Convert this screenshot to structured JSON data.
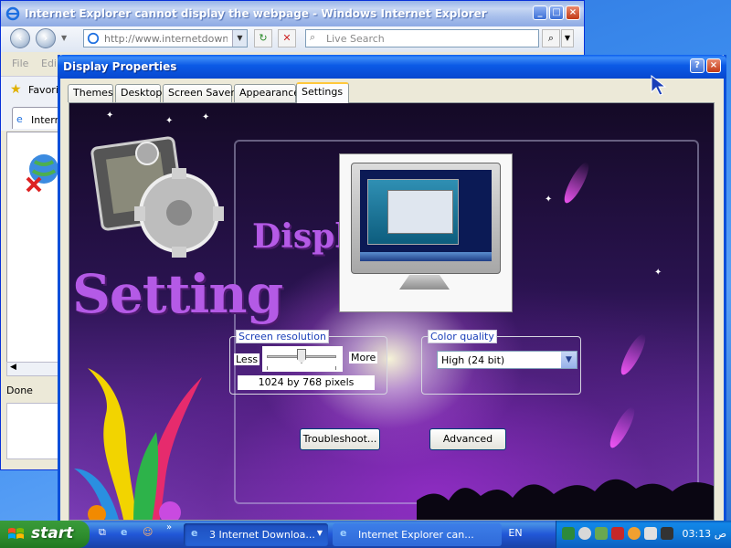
{
  "ie_window": {
    "title": "Internet Explorer cannot display the webpage - Windows Internet Explorer",
    "address": "http://www.internetdownl...",
    "search_placeholder": "Live Search",
    "menu_items": [
      "File",
      "Edi"
    ],
    "favorites_label": "Favorit",
    "tab_label": "Intern",
    "status": "Done"
  },
  "dialog": {
    "title": "Display Properties",
    "tabs": [
      "Themes",
      "Desktop",
      "Screen Saver",
      "Appearance",
      "Settings"
    ],
    "active_tab": "Settings",
    "background_text_setting": "Setting",
    "background_text_display": "Displ",
    "screen_resolution": {
      "legend": "Screen resolution",
      "less_label": "Less",
      "more_label": "More",
      "value": "1024 by 768 pixels",
      "slider_fraction": 0.5
    },
    "color_quality": {
      "legend": "Color quality",
      "selected": "High (24 bit)"
    },
    "troubleshoot_button": "Troubleshoot...",
    "advanced_button": "Advanced"
  },
  "taskbar": {
    "start_label": "start",
    "tasks": [
      {
        "label": "3 Internet Downloa...",
        "icon": "ie-icon"
      },
      {
        "label": "Internet Explorer can...",
        "icon": "ie-icon"
      }
    ],
    "language": "EN",
    "clock": "03:13 ص"
  },
  "colors": {
    "xp_blue": "#0a5eef",
    "start_green": "#2f8f2f",
    "purple_text": "#b45ae6"
  }
}
